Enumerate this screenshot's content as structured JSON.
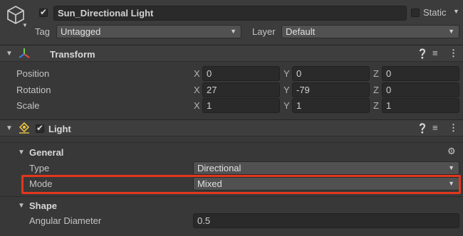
{
  "header": {
    "object_name": "Sun_Directional Light",
    "active": true,
    "static_label": "Static",
    "tag_label": "Tag",
    "tag_value": "Untagged",
    "layer_label": "Layer",
    "layer_value": "Default"
  },
  "transform": {
    "title": "Transform",
    "rows": [
      {
        "label": "Position",
        "x": "0",
        "y": "0",
        "z": "0"
      },
      {
        "label": "Rotation",
        "x": "27",
        "y": "-79",
        "z": "0"
      },
      {
        "label": "Scale",
        "x": "1",
        "y": "1",
        "z": "1"
      }
    ],
    "axes": {
      "x": "X",
      "y": "Y",
      "z": "Z"
    }
  },
  "light": {
    "title": "Light",
    "enabled": true,
    "general": {
      "title": "General",
      "type_label": "Type",
      "type_value": "Directional",
      "mode_label": "Mode",
      "mode_value": "Mixed"
    },
    "shape": {
      "title": "Shape",
      "angular_label": "Angular Diameter",
      "angular_value": "0.5"
    }
  },
  "colors": {
    "highlight": "#e2371c",
    "panel": "#383838"
  }
}
